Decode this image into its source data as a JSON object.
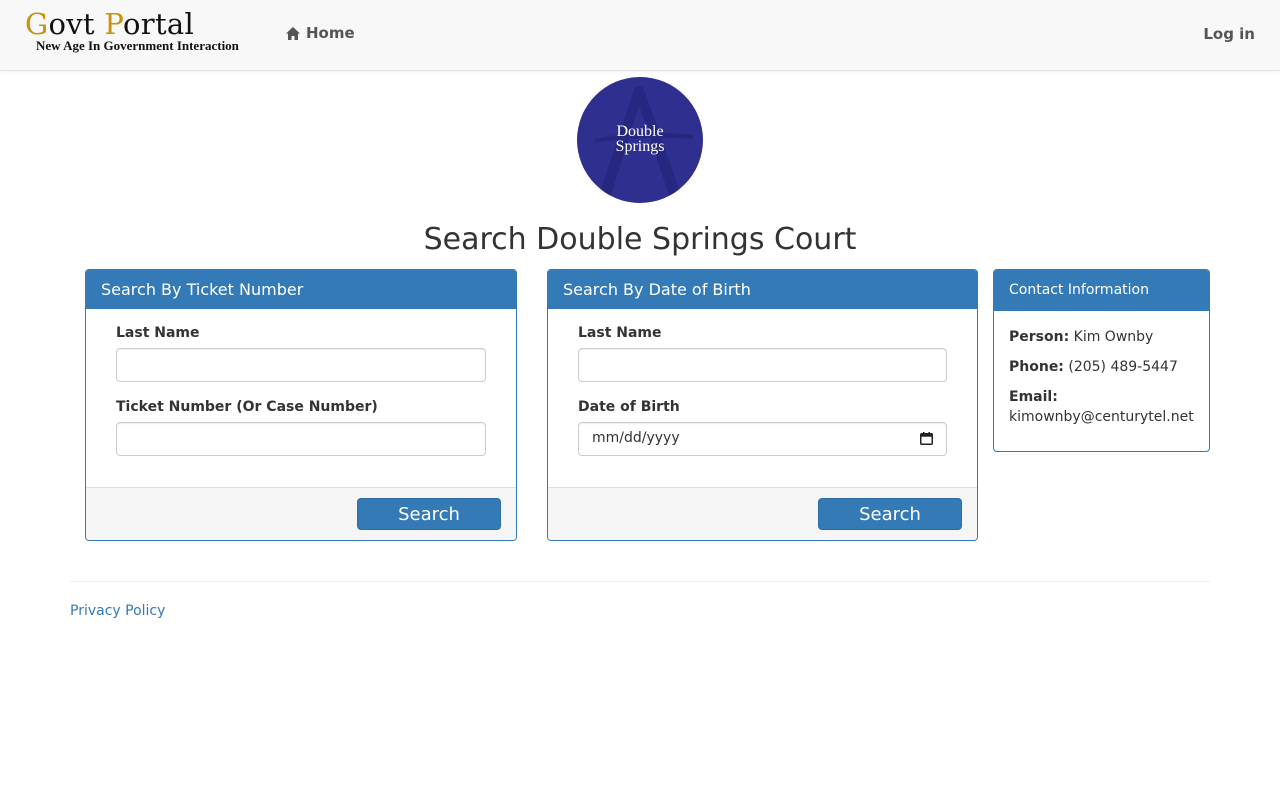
{
  "navbar": {
    "brand_g": "G",
    "brand_ovt": "ovt ",
    "brand_p": "P",
    "brand_ortal": "ortal",
    "brand_tagline": "New Age In Government Interaction",
    "home_label": "Home",
    "login_label": "Log in",
    "accent_color": "#c9930e"
  },
  "seal": {
    "line1": "Double",
    "line2": "Springs",
    "color": "#2e2f8e"
  },
  "page_title": "Search Double Springs Court",
  "ticket_panel": {
    "heading": "Search By Ticket Number",
    "last_name_label": "Last Name",
    "last_name_value": "",
    "ticket_label": "Ticket Number (Or Case Number)",
    "ticket_value": "",
    "search_label": "Search"
  },
  "dob_panel": {
    "heading": "Search By Date of Birth",
    "last_name_label": "Last Name",
    "last_name_value": "",
    "dob_label": "Date of Birth",
    "dob_placeholder": "mm/dd/yyyy",
    "search_label": "Search"
  },
  "contact_panel": {
    "heading": "Contact Information",
    "person_label": "Person:",
    "person_value": "Kim Ownby",
    "phone_label": "Phone:",
    "phone_value": "(205) 489-5447",
    "email_label": "Email:",
    "email_value": "kimownby@centurytel.net"
  },
  "footer": {
    "privacy_label": "Privacy Policy"
  },
  "colors": {
    "primary": "#337ab7",
    "navbar_bg": "#f8f8f8"
  }
}
